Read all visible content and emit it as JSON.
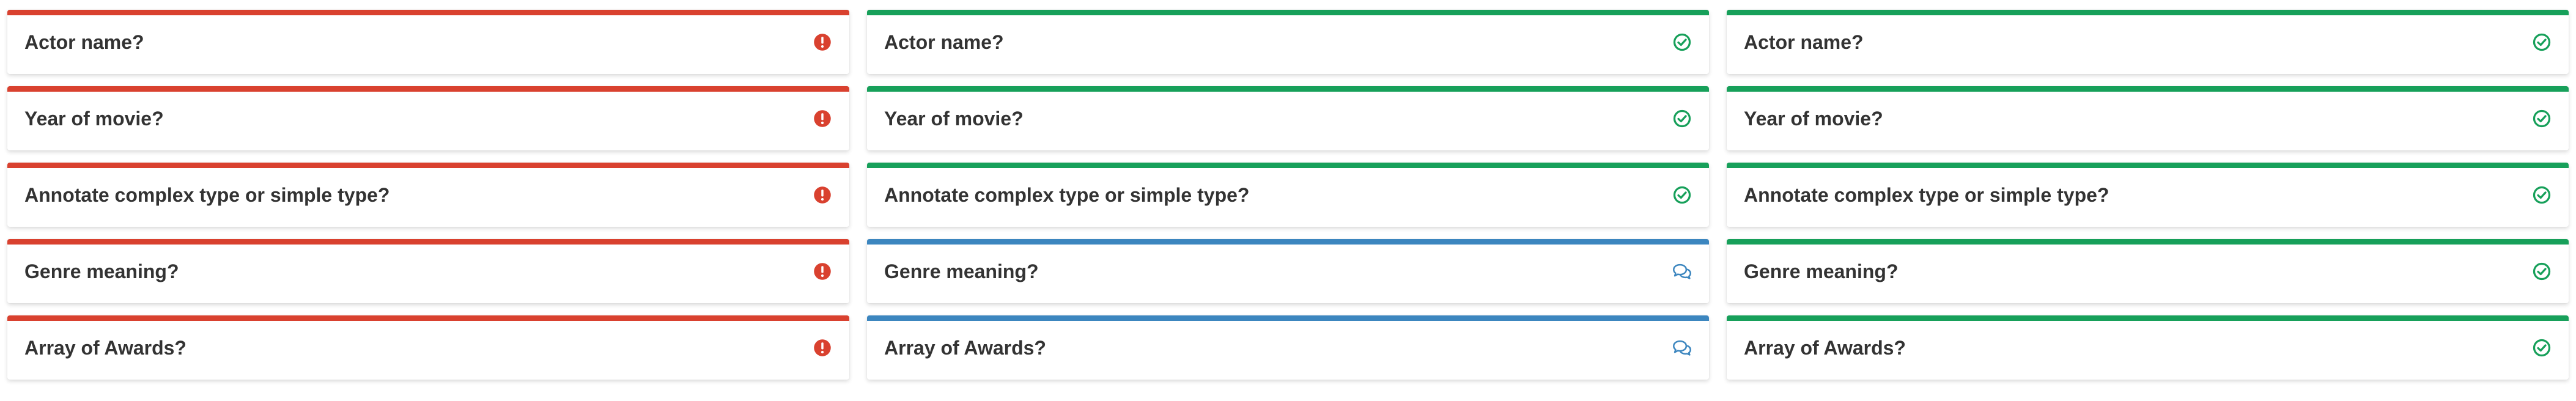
{
  "colors": {
    "error": "#d9412f",
    "ok": "#17a05a",
    "comment": "#3c86bf",
    "text": "#333333"
  },
  "columns": [
    {
      "cards": [
        {
          "label": "Actor name?",
          "status": "error",
          "icon": "alert-icon"
        },
        {
          "label": "Year of movie?",
          "status": "error",
          "icon": "alert-icon"
        },
        {
          "label": "Annotate complex type or simple type?",
          "status": "error",
          "icon": "alert-icon"
        },
        {
          "label": "Genre meaning?",
          "status": "error",
          "icon": "alert-icon"
        },
        {
          "label": "Array of Awards?",
          "status": "error",
          "icon": "alert-icon"
        }
      ]
    },
    {
      "cards": [
        {
          "label": "Actor name?",
          "status": "ok",
          "icon": "check-circle-icon"
        },
        {
          "label": "Year of movie?",
          "status": "ok",
          "icon": "check-circle-icon"
        },
        {
          "label": "Annotate complex type or simple type?",
          "status": "ok",
          "icon": "check-circle-icon"
        },
        {
          "label": "Genre meaning?",
          "status": "comment",
          "icon": "comments-icon"
        },
        {
          "label": "Array of Awards?",
          "status": "comment",
          "icon": "comments-icon"
        }
      ]
    },
    {
      "cards": [
        {
          "label": "Actor name?",
          "status": "ok",
          "icon": "check-circle-icon"
        },
        {
          "label": "Year of movie?",
          "status": "ok",
          "icon": "check-circle-icon"
        },
        {
          "label": "Annotate complex type or simple type?",
          "status": "ok",
          "icon": "check-circle-icon"
        },
        {
          "label": "Genre meaning?",
          "status": "ok",
          "icon": "check-circle-icon"
        },
        {
          "label": "Array of Awards?",
          "status": "ok",
          "icon": "check-circle-icon"
        }
      ]
    }
  ]
}
